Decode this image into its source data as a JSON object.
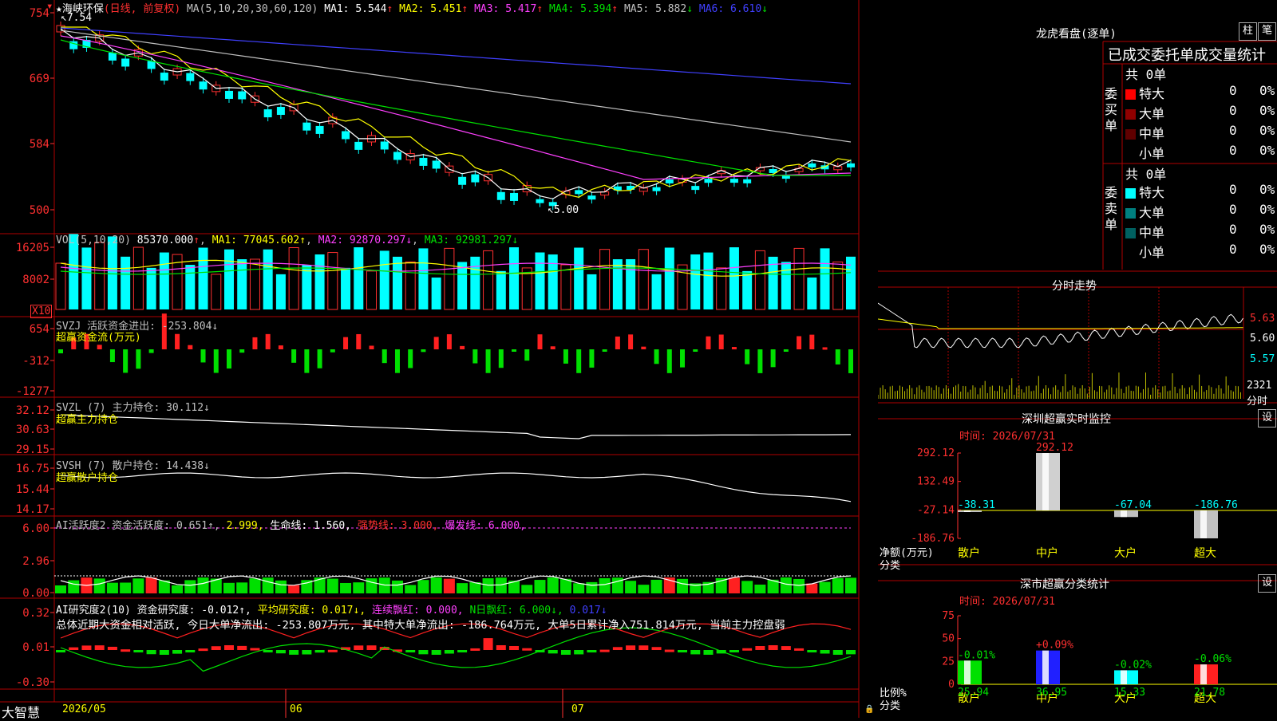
{
  "title": {
    "star": "★",
    "stock": "海峡环保",
    "mode": "(日线, 前复权)",
    "ma_label": "MA(5,10,20,30,60,120)",
    "ma": [
      {
        "name": "MA1:",
        "value": "5.544",
        "arrow": "↑",
        "color": "#ffffff"
      },
      {
        "name": "MA2:",
        "value": "5.451",
        "arrow": "↑",
        "color": "#ffff00"
      },
      {
        "name": "MA3:",
        "value": "5.417",
        "arrow": "↑",
        "color": "#ff40ff"
      },
      {
        "name": "MA4:",
        "value": "5.394",
        "arrow": "↑",
        "color": "#00e000"
      },
      {
        "name": "MA5:",
        "value": "5.882",
        "arrow": "↓",
        "color": "#c0c0c0"
      },
      {
        "name": "MA6:",
        "value": "6.610",
        "arrow": "↓",
        "color": "#4040ff"
      }
    ]
  },
  "colors": {
    "up": "#ff3030",
    "down": "#00ffff",
    "grid": "#b00000",
    "axis": "#ff3030",
    "ma1": "#ffffff",
    "ma2": "#ffff00",
    "ma3": "#ff40ff",
    "ma4": "#00e000",
    "ma5": "#c0c0c0",
    "ma6": "#4040ff"
  },
  "price_axis": {
    "ticks": [
      "754",
      "669",
      "584",
      "500"
    ],
    "high_label": "7.54",
    "low_label": "5.00"
  },
  "vol": {
    "header": "VOL(5,10,20)",
    "value": "85370.000",
    "arrow": "↑",
    "ma1": "MA1: 77045.602↑",
    "ma2": "MA2: 92870.297↓",
    "ma3": "MA3: 92981.297↓",
    "ticks": [
      "16205",
      "8002"
    ],
    "unit": "X10"
  },
  "svzj": {
    "header": "SVZJ  活跃资金进出: -253.804↓",
    "sub": "超赢资金流(万元)",
    "ticks": [
      "654",
      "-312",
      "-1277"
    ]
  },
  "svzl": {
    "header": "SVZL (7) 主力持仓: 30.112↓",
    "sub": "超赢主力持仓",
    "ticks": [
      "32.12",
      "30.63",
      "29.15"
    ]
  },
  "svsh": {
    "header": "SVSH (7) 散户持仓: 14.438↓",
    "sub": "超赢散户持仓",
    "ticks": [
      "16.75",
      "15.44",
      "14.17"
    ]
  },
  "ai1": {
    "header": "AI活跃度2 资金活跃度: 0.651↑,",
    "v2": "2.999,",
    "life": "生命线: 1.560,",
    "strong": "强势线: 3.000,",
    "burst": "爆发线: 6.000,",
    "ticks": [
      "6.00",
      "2.96",
      "0.00"
    ]
  },
  "ai2": {
    "header": "AI研究度2(10) 资金研究度: -0.012↑,",
    "avg": "平均研究度: 0.017↓,",
    "cont": "连续飘红: 0.000,",
    "nday": "N日飘红: 6.000↓,",
    "last": "0.017↓",
    "ticks": [
      "0.32",
      "0.01",
      "-0.30"
    ],
    "summary": "总体近期大资金相对活跃, 今日大单净流出: -253.807万元, 其中特大单净流出: -186.764万元, 大单5日累计净入751.814万元, 当前主力控盘弱"
  },
  "bottom": {
    "brand": "大智慧",
    "dates": [
      "2026/05",
      "06",
      "07"
    ]
  },
  "lhb": {
    "title": "龙虎看盘(逐单)",
    "btn1": "柱",
    "btn2": "笔",
    "table_title": "已成交委托单成交量统计",
    "buy": {
      "side": "委买单",
      "total": "共 0单",
      "rows": [
        {
          "name": "特大",
          "count": "0",
          "pct": "0%",
          "color": "#ff0000"
        },
        {
          "name": "大单",
          "count": "0",
          "pct": "0%",
          "color": "#900000"
        },
        {
          "name": "中单",
          "count": "0",
          "pct": "0%",
          "color": "#600000"
        },
        {
          "name": "小单",
          "count": "0",
          "pct": "0%",
          "color": "#000000"
        }
      ]
    },
    "sell": {
      "side": "委卖单",
      "total": "共 0单",
      "rows": [
        {
          "name": "特大",
          "count": "0",
          "pct": "0%",
          "color": "#00ffff"
        },
        {
          "name": "大单",
          "count": "0",
          "pct": "0%",
          "color": "#008080"
        },
        {
          "name": "中单",
          "count": "0",
          "pct": "0%",
          "color": "#006060"
        },
        {
          "name": "小单",
          "count": "0",
          "pct": "0%",
          "color": "#000000"
        }
      ]
    }
  },
  "fenshi": {
    "title": "分时走势",
    "ticks": [
      "5.63",
      "5.60",
      "5.57"
    ],
    "vol": "2321",
    "vol_label": "分时"
  },
  "monitor": {
    "title": "深圳超赢实时监控",
    "btn": "设",
    "time": "时间: 2026/07/31",
    "ticks": [
      "292.12",
      "132.49",
      "-27.14",
      "-186.76"
    ],
    "ylabel": "净额(万元)",
    "xlabel": "分类",
    "chart_data": {
      "type": "bar",
      "categories": [
        "散户",
        "中户",
        "大户",
        "超大"
      ],
      "values": [
        -38.31,
        292.12,
        -67.04,
        -186.76
      ],
      "labels": [
        "-38.31",
        "292.12",
        "-67.04",
        "-186.76"
      ],
      "ylim": [
        -186.76,
        292.12
      ]
    }
  },
  "classstat": {
    "title": "深市超赢分类统计",
    "btn": "设",
    "time": "时间: 2026/07/31",
    "ticks": [
      "75",
      "50",
      "25",
      "0"
    ],
    "ylabel": "比例%",
    "xlabel": "分类",
    "chart_data": {
      "type": "bar",
      "categories": [
        "散户",
        "中户",
        "大户",
        "超大"
      ],
      "values": [
        25.94,
        36.95,
        15.33,
        21.78
      ],
      "changes": [
        "-0.01%",
        "+0.09%",
        "-0.02%",
        "-0.06%"
      ],
      "labels": [
        "25.94",
        "36.95",
        "15.33",
        "21.78"
      ],
      "ylim": [
        0,
        75
      ]
    }
  }
}
